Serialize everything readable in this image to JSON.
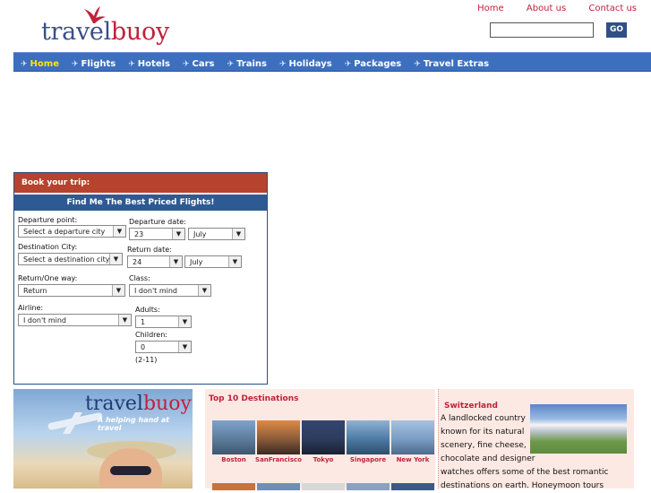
{
  "header": {
    "logo": {
      "part1": "travel",
      "part2": "buoy"
    },
    "links": [
      "Home",
      "About us",
      "Contact us"
    ],
    "search": {
      "value": "",
      "button": "GO"
    }
  },
  "nav": {
    "items": [
      "Home",
      "Flights",
      "Hotels",
      "Cars",
      "Trains",
      "Holidays",
      "Packages",
      "Travel Extras"
    ],
    "active": "Home"
  },
  "booking": {
    "title": "Book your trip:",
    "subtitle": "Find Me The Best Priced Flights!",
    "departure_point_label": "Departure point:",
    "departure_point_value": "Select a departure city",
    "destination_label": "Destination City:",
    "destination_value": "Select a destination city",
    "departure_date_label": "Departure date:",
    "departure_day": "23",
    "departure_month": "July",
    "return_date_label": "Return date:",
    "return_day": "24",
    "return_month": "July",
    "trip_type_label": "Return/One way:",
    "trip_type_value": "Return",
    "class_label": "Class:",
    "class_value": "I don't mind",
    "airline_label": "Airline:",
    "airline_value": "I don't mind",
    "adults_label": "Adults:",
    "adults_value": "1",
    "children_label": "Children:",
    "children_value": "0",
    "children_note": "(2-11)"
  },
  "promo": {
    "logo1": "travel",
    "logo2": "buoy",
    "tagline": "A helping hand at travel"
  },
  "destinations": {
    "title": "Top 10 Destinations",
    "items": [
      "Boston",
      "SanFrancisco",
      "Tokyo",
      "Singapore",
      "New York"
    ],
    "colors": [
      "#6c8fb5",
      "#8a5b3a",
      "#2d3c5e",
      "#4d7aa3",
      "#7a9dc3"
    ]
  },
  "featured": {
    "title": "Switzerland",
    "text": "A landlocked country known for its natural scenery, fine cheese, chocolate and designer watches offers some of the best romantic destinations on earth. Honeymoon tours"
  }
}
